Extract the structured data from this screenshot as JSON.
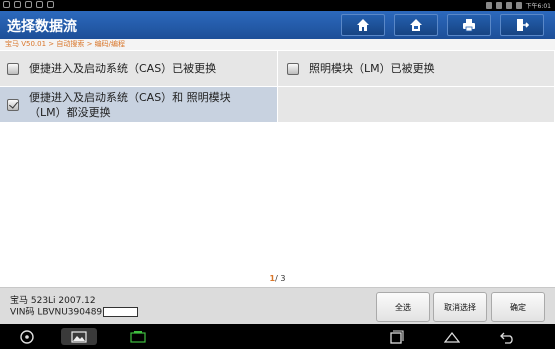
{
  "status_bar": {
    "time": "下午6:01"
  },
  "header": {
    "title": "选择数据流",
    "buttons": [
      {
        "icon": "home-icon"
      },
      {
        "icon": "vehicle-home-icon"
      },
      {
        "icon": "print-icon"
      },
      {
        "icon": "exit-icon"
      }
    ]
  },
  "breadcrumb": "宝马 V50.01 > 自动搜索 > 编码/编程",
  "options": [
    {
      "label": "便捷进入及启动系统（CAS）已被更换",
      "checked": false
    },
    {
      "label": "照明模块（LM）已被更换",
      "checked": false
    },
    {
      "label": "便捷进入及启动系统（CAS）和 照明模块（LM）都没更换",
      "checked": true
    }
  ],
  "pager": {
    "current": "1",
    "total": "/ 3"
  },
  "vehicle": {
    "model": "宝马 523Li 2007.12",
    "vin_label": "VIN码 LBVNU390489"
  },
  "actions": {
    "select_all": "全选",
    "cancel_select": "取消选择",
    "confirm": "确定"
  },
  "colors": {
    "header_blue": "#2c69bd",
    "accent_orange": "#d9762a",
    "selected_row": "#c8d2e0"
  }
}
